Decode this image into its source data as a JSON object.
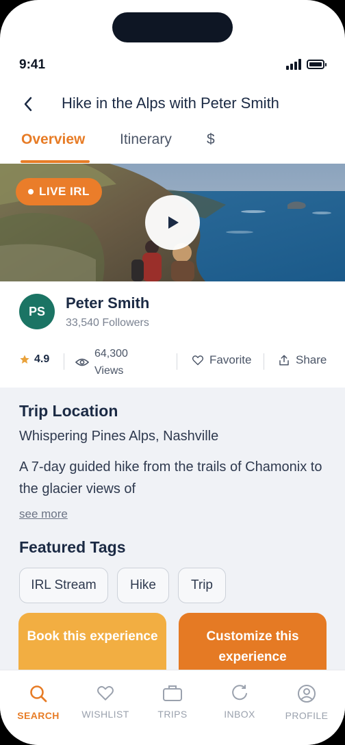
{
  "status_bar": {
    "time": "9:41"
  },
  "header": {
    "title": "Hike in the Alps with Peter Smith"
  },
  "tabs": [
    {
      "label": "Overview",
      "active": true
    },
    {
      "label": "Itinerary",
      "active": false
    },
    {
      "label": "$",
      "active": false
    }
  ],
  "hero": {
    "badge": "LIVE IRL"
  },
  "host": {
    "initials": "PS",
    "name": "Peter Smith",
    "followers": "33,540 Followers",
    "avatar_color": "#1b7464"
  },
  "stats": {
    "rating": "4.9",
    "views_count": "64,300",
    "views_label": "Views",
    "favorite": "Favorite",
    "share": "Share"
  },
  "trip": {
    "location_title": "Trip Location",
    "location": "Whispering Pines Alps, Nashville",
    "description": "A 7-day guided hike from the trails of Chamonix to the glacier views of",
    "see_more": "see more"
  },
  "tags": {
    "title": "Featured Tags",
    "items": [
      "IRL Stream",
      "Hike",
      "Trip"
    ]
  },
  "actions": {
    "book": "Book this experience",
    "customize_line1": "Customize this",
    "customize_line2": "experience"
  },
  "nav": [
    {
      "label": "SEARCH",
      "icon": "search-icon",
      "active": true
    },
    {
      "label": "WISHLIST",
      "icon": "heart-icon",
      "active": false
    },
    {
      "label": "TRIPS",
      "icon": "briefcase-icon",
      "active": false
    },
    {
      "label": "INBOX",
      "icon": "chat-icon",
      "active": false
    },
    {
      "label": "PROFILE",
      "icon": "user-circle-icon",
      "active": false
    }
  ],
  "colors": {
    "accent": "#e77c26",
    "book_button": "#f2ae42",
    "customize_button": "#e57a24",
    "text_dark": "#1b2a44"
  }
}
